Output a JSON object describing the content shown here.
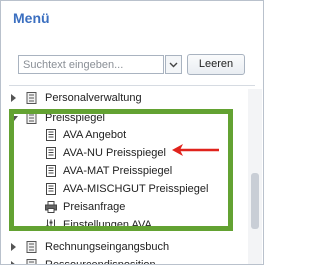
{
  "menu": {
    "title": "Menü"
  },
  "search": {
    "placeholder": "Suchtext eingeben...",
    "clear_label": "Leeren"
  },
  "tree": [
    {
      "label": "Personalverwaltung",
      "expanded": false
    },
    {
      "label": "Preisspiegel",
      "expanded": true,
      "children": [
        {
          "label": "AVA Angebot",
          "icon": "document-icon"
        },
        {
          "label": "AVA-NU Preisspiegel",
          "icon": "document-icon"
        },
        {
          "label": "AVA-MAT Preisspiegel",
          "icon": "document-icon"
        },
        {
          "label": "AVA-MISCHGUT Preisspiegel",
          "icon": "document-icon"
        },
        {
          "label": "Preisanfrage",
          "icon": "printer-icon"
        },
        {
          "label": "Einstellungen AVA",
          "icon": "settings-sliders-icon"
        }
      ]
    },
    {
      "label": "Rechnungseingangsbuch",
      "expanded": false
    },
    {
      "label": "Ressourcendisposition",
      "expanded": false
    }
  ],
  "annotations": {
    "highlight_color": "#63a232",
    "arrow_color": "#e0231c"
  }
}
